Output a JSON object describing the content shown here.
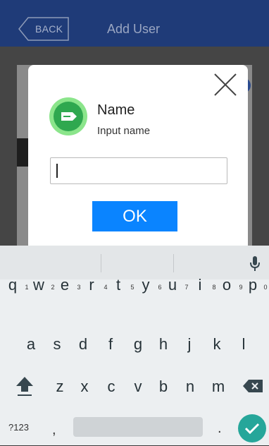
{
  "app": {
    "back_label": "BACK",
    "title": "Add User"
  },
  "dialog": {
    "field_label": "Name",
    "field_hint": "Input name",
    "input_value": "",
    "ok_label": "OK",
    "icons": {
      "close": "close-icon",
      "field": "tag-icon"
    }
  },
  "keyboard": {
    "row1": [
      {
        "key": "q",
        "hint": "1"
      },
      {
        "key": "w",
        "hint": "2"
      },
      {
        "key": "e",
        "hint": "3"
      },
      {
        "key": "r",
        "hint": "4"
      },
      {
        "key": "t",
        "hint": "5"
      },
      {
        "key": "y",
        "hint": "6"
      },
      {
        "key": "u",
        "hint": "7"
      },
      {
        "key": "i",
        "hint": "8"
      },
      {
        "key": "o",
        "hint": "9"
      },
      {
        "key": "p",
        "hint": "0"
      }
    ],
    "row2": [
      "a",
      "s",
      "d",
      "f",
      "g",
      "h",
      "j",
      "k",
      "l"
    ],
    "row3": [
      "z",
      "x",
      "c",
      "v",
      "b",
      "n",
      "m"
    ],
    "symbols_label": "?123",
    "comma_label": ",",
    "period_label": ".",
    "enter_color": "#26a69a",
    "accent_color": "#0a84ff"
  }
}
